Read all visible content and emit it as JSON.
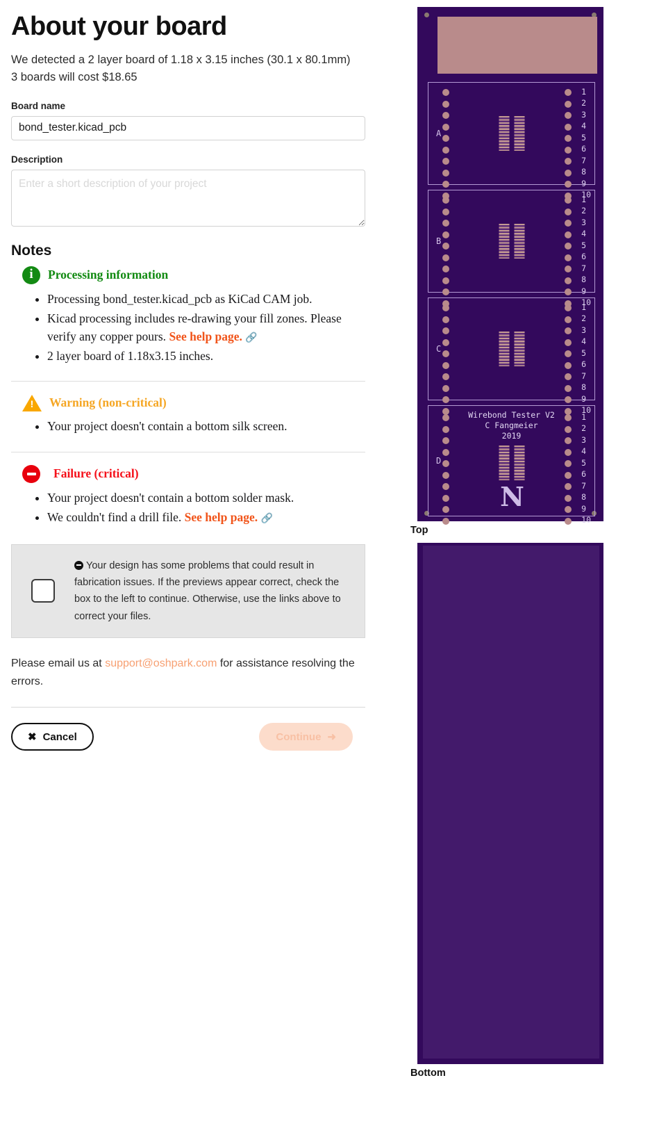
{
  "page": {
    "title": "About your board",
    "detect_line_1": "We detected a 2 layer board of 1.18 x 3.15 inches (30.1 x 80.1mm)",
    "detect_line_2": "3 boards will cost $18.65"
  },
  "form": {
    "board_name_label": "Board name",
    "board_name_value": "bond_tester.kicad_pcb",
    "description_label": "Description",
    "description_value": "",
    "description_placeholder": "Enter a short description of your project"
  },
  "notes": {
    "heading": "Notes",
    "groups": [
      {
        "icon": "info-circle-icon",
        "severity": "info",
        "title": "Processing information",
        "items": [
          {
            "text": "Processing bond_tester.kicad_pcb as KiCad CAM job.",
            "link": null
          },
          {
            "text": "Kicad processing includes re-drawing your fill zones. Please verify any copper pours. ",
            "link": "See help page."
          },
          {
            "text": "2 layer board of 1.18x3.15 inches.",
            "link": null
          }
        ]
      },
      {
        "icon": "warning-triangle-icon",
        "severity": "warn",
        "title": "Warning (non-critical)",
        "items": [
          {
            "text": "Your project doesn't contain a bottom silk screen.",
            "link": null
          }
        ]
      },
      {
        "icon": "error-circle-icon",
        "severity": "fail",
        "title": "Failure (critical)",
        "items": [
          {
            "text": "Your project doesn't contain a bottom solder mask.",
            "link": null
          },
          {
            "text": "We couldn't find a drill file. ",
            "link": "See help page."
          }
        ]
      }
    ]
  },
  "acknowledge": {
    "text": "Your design has some problems that could result in fabrication issues. If the previews appear correct, check the box to the left to continue. Otherwise, use the links above to correct your files.",
    "checked": false
  },
  "support": {
    "prefix": "Please email us at ",
    "email": "support@oshpark.com",
    "suffix": " for assistance resolving the errors."
  },
  "actions": {
    "cancel_label": "Cancel",
    "cancel_icon": "close-x-icon",
    "continue_label": "Continue",
    "continue_icon": "arrow-right-icon",
    "continue_disabled": true
  },
  "previews": {
    "top_label": "Top",
    "bottom_label": "Bottom",
    "colors": {
      "soldermask": "#33095c",
      "copper": "#b98b8b",
      "silkscreen": "#dcd0ee",
      "bottom_fill": "#431a6b"
    },
    "sections": [
      {
        "letter": "A",
        "pin_numbers": [
          "1",
          "2",
          "3",
          "4",
          "5",
          "6",
          "7",
          "8",
          "9",
          "10"
        ]
      },
      {
        "letter": "B",
        "pin_numbers": [
          "1",
          "2",
          "3",
          "4",
          "5",
          "6",
          "7",
          "8",
          "9",
          "10"
        ]
      },
      {
        "letter": "C",
        "pin_numbers": [
          "1",
          "2",
          "3",
          "4",
          "5",
          "6",
          "7",
          "8",
          "9",
          "10"
        ]
      },
      {
        "letter": "D",
        "pin_numbers": [
          "1",
          "2",
          "3",
          "4",
          "5",
          "6",
          "7",
          "8",
          "9",
          "10"
        ]
      }
    ],
    "silkscreen_text": {
      "line1": "Wirebond Tester V2",
      "line2": "C Fangmeier",
      "line3": "2019",
      "logo": "N"
    }
  },
  "accent": {
    "orange": "#f1541a",
    "green": "#118a11",
    "amber": "#f5a623",
    "red": "#f5101a",
    "email_link": "#f7a072"
  }
}
